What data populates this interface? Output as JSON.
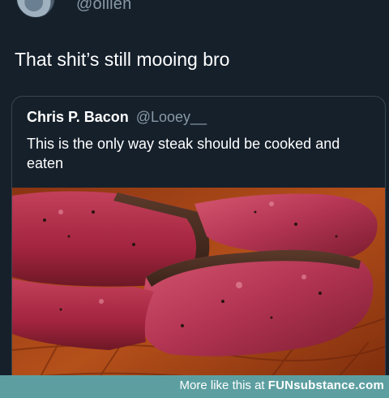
{
  "tweet": {
    "author_handle": "@ollien",
    "text": "That shit’s still mooing bro"
  },
  "quoted_tweet": {
    "author_name": "Chris P. Bacon",
    "author_handle": "@Looey__",
    "text": "This is the only way steak should be cooked and eaten",
    "image": "sliced-rare-steak-on-wooden-board"
  },
  "watermark": {
    "prefix": "More like this at",
    "brand": "FUNsubstance.com",
    "color": "#5d9fa1"
  },
  "colors": {
    "background": "#15202b",
    "secondary_text": "#8899a6",
    "card_border": "#38444d"
  }
}
